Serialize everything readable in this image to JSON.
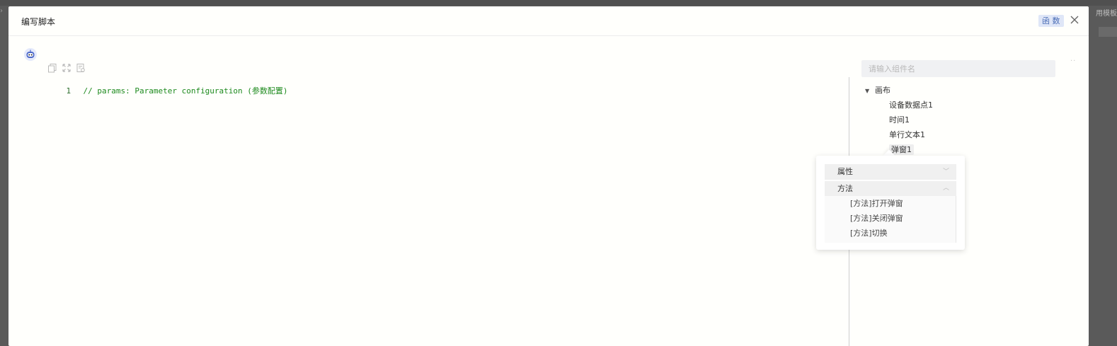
{
  "modal": {
    "title": "编写脚本",
    "function_badge": "函 数",
    "close_label": "×"
  },
  "background": {
    "right_label": "用模板"
  },
  "editor": {
    "lines": [
      {
        "number": "1",
        "text": "// params: Parameter configuration (参数配置)"
      }
    ]
  },
  "side_panel": {
    "search_placeholder": "请输入组件名",
    "tree": {
      "root_label": "画布",
      "children": [
        "设备数据点1",
        "时间1",
        "单行文本1",
        "弹窗1"
      ]
    }
  },
  "popover": {
    "properties_label": "属性",
    "methods_label": "方法",
    "methods": [
      "[方法]打开弹窗",
      "[方法]关闭弹窗",
      "[方法]切换"
    ]
  },
  "icons": [
    "robot-icon",
    "copy-icon",
    "fullscreen-icon",
    "format-icon",
    "close-icon",
    "caret-down-icon",
    "chevron-down-icon",
    "chevron-up-icon"
  ],
  "colors": {
    "comment_green": "#1d8a1d",
    "badge_bg": "#dfe6f7",
    "badge_text": "#4a6db5"
  }
}
